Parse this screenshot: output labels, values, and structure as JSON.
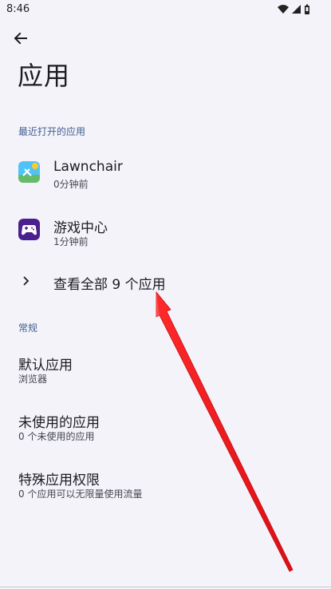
{
  "status_bar": {
    "time": "8:46",
    "icons": [
      "wifi-icon",
      "signal-icon",
      "battery-icon"
    ]
  },
  "header": {
    "back_icon": "arrow-left-icon",
    "title": "应用"
  },
  "recent": {
    "header": "最近打开的应用",
    "apps": [
      {
        "name": "Lawnchair",
        "time": "0分钟前",
        "icon": "lawnchair-icon"
      },
      {
        "name": "游戏中心",
        "time": "1分钟前",
        "icon": "game-center-icon"
      }
    ],
    "see_all": "查看全部 9 个应用"
  },
  "general": {
    "header": "常规",
    "items": [
      {
        "title": "默认应用",
        "subtitle": "浏览器"
      },
      {
        "title": "未使用的应用",
        "subtitle": "0 个未使用的应用"
      },
      {
        "title": "特殊应用权限",
        "subtitle": "0 个应用可以无限量使用流量"
      }
    ]
  },
  "colors": {
    "background": "#f4f3f9",
    "section_header": "#3f5f91",
    "annotation_arrow": "#e8141b"
  }
}
